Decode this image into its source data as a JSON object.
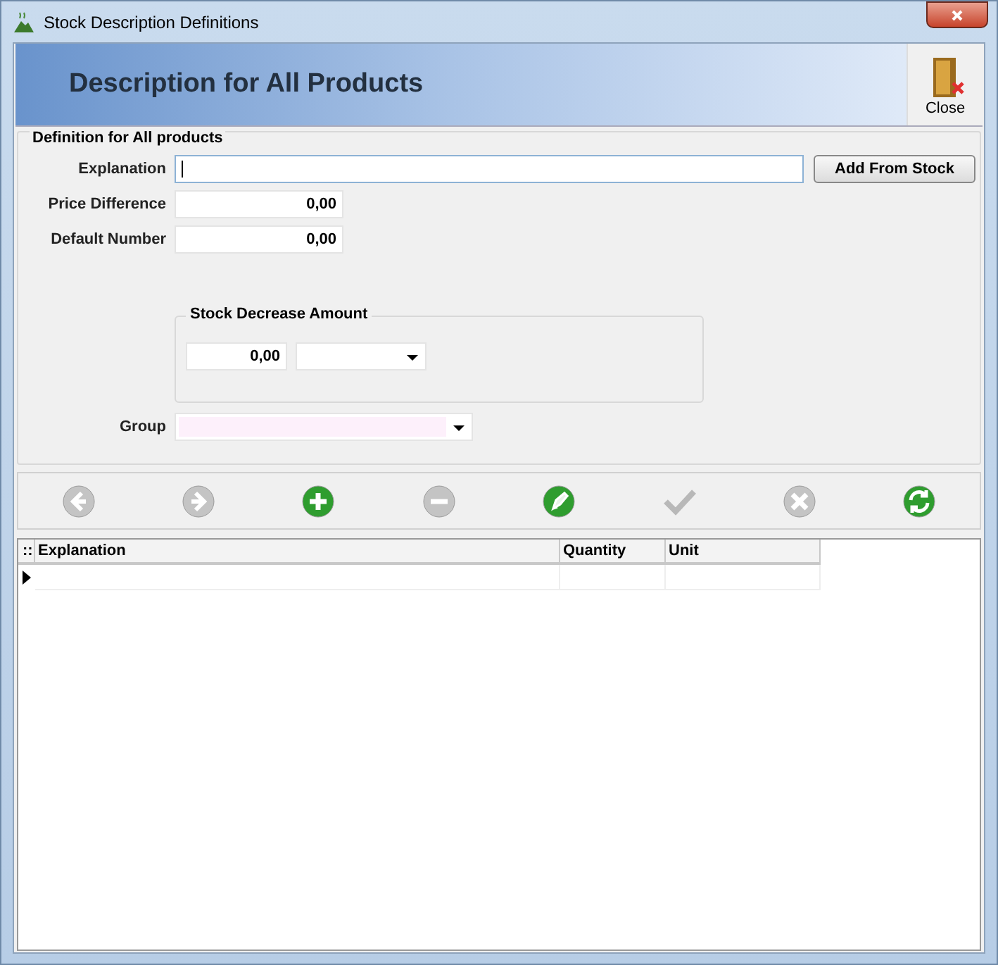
{
  "window": {
    "title": "Stock Description Definitions"
  },
  "header": {
    "title": "Description for All Products",
    "close_label": "Close"
  },
  "form": {
    "legend": "Definition for All products",
    "explanation": {
      "label": "Explanation"
    },
    "add_button": "Add From Stock",
    "price_difference": {
      "label": "Price Difference",
      "value": "0,00"
    },
    "default_number": {
      "label": "Default Number",
      "value": "0,00"
    },
    "stock_decrease": {
      "legend": "Stock Decrease Amount",
      "value": "0,00"
    },
    "group": {
      "label": "Group"
    }
  },
  "toolbar": [
    {
      "kind": "prev",
      "disabled": true
    },
    {
      "kind": "next",
      "disabled": true
    },
    {
      "kind": "add",
      "disabled": false
    },
    {
      "kind": "delete",
      "disabled": true
    },
    {
      "kind": "edit",
      "disabled": false
    },
    {
      "kind": "confirm",
      "disabled": true
    },
    {
      "kind": "cancel",
      "disabled": true
    },
    {
      "kind": "refresh",
      "disabled": false
    }
  ],
  "grid": {
    "corner": "::",
    "columns": [
      "Explanation",
      "Quantity",
      "Unit"
    ]
  }
}
